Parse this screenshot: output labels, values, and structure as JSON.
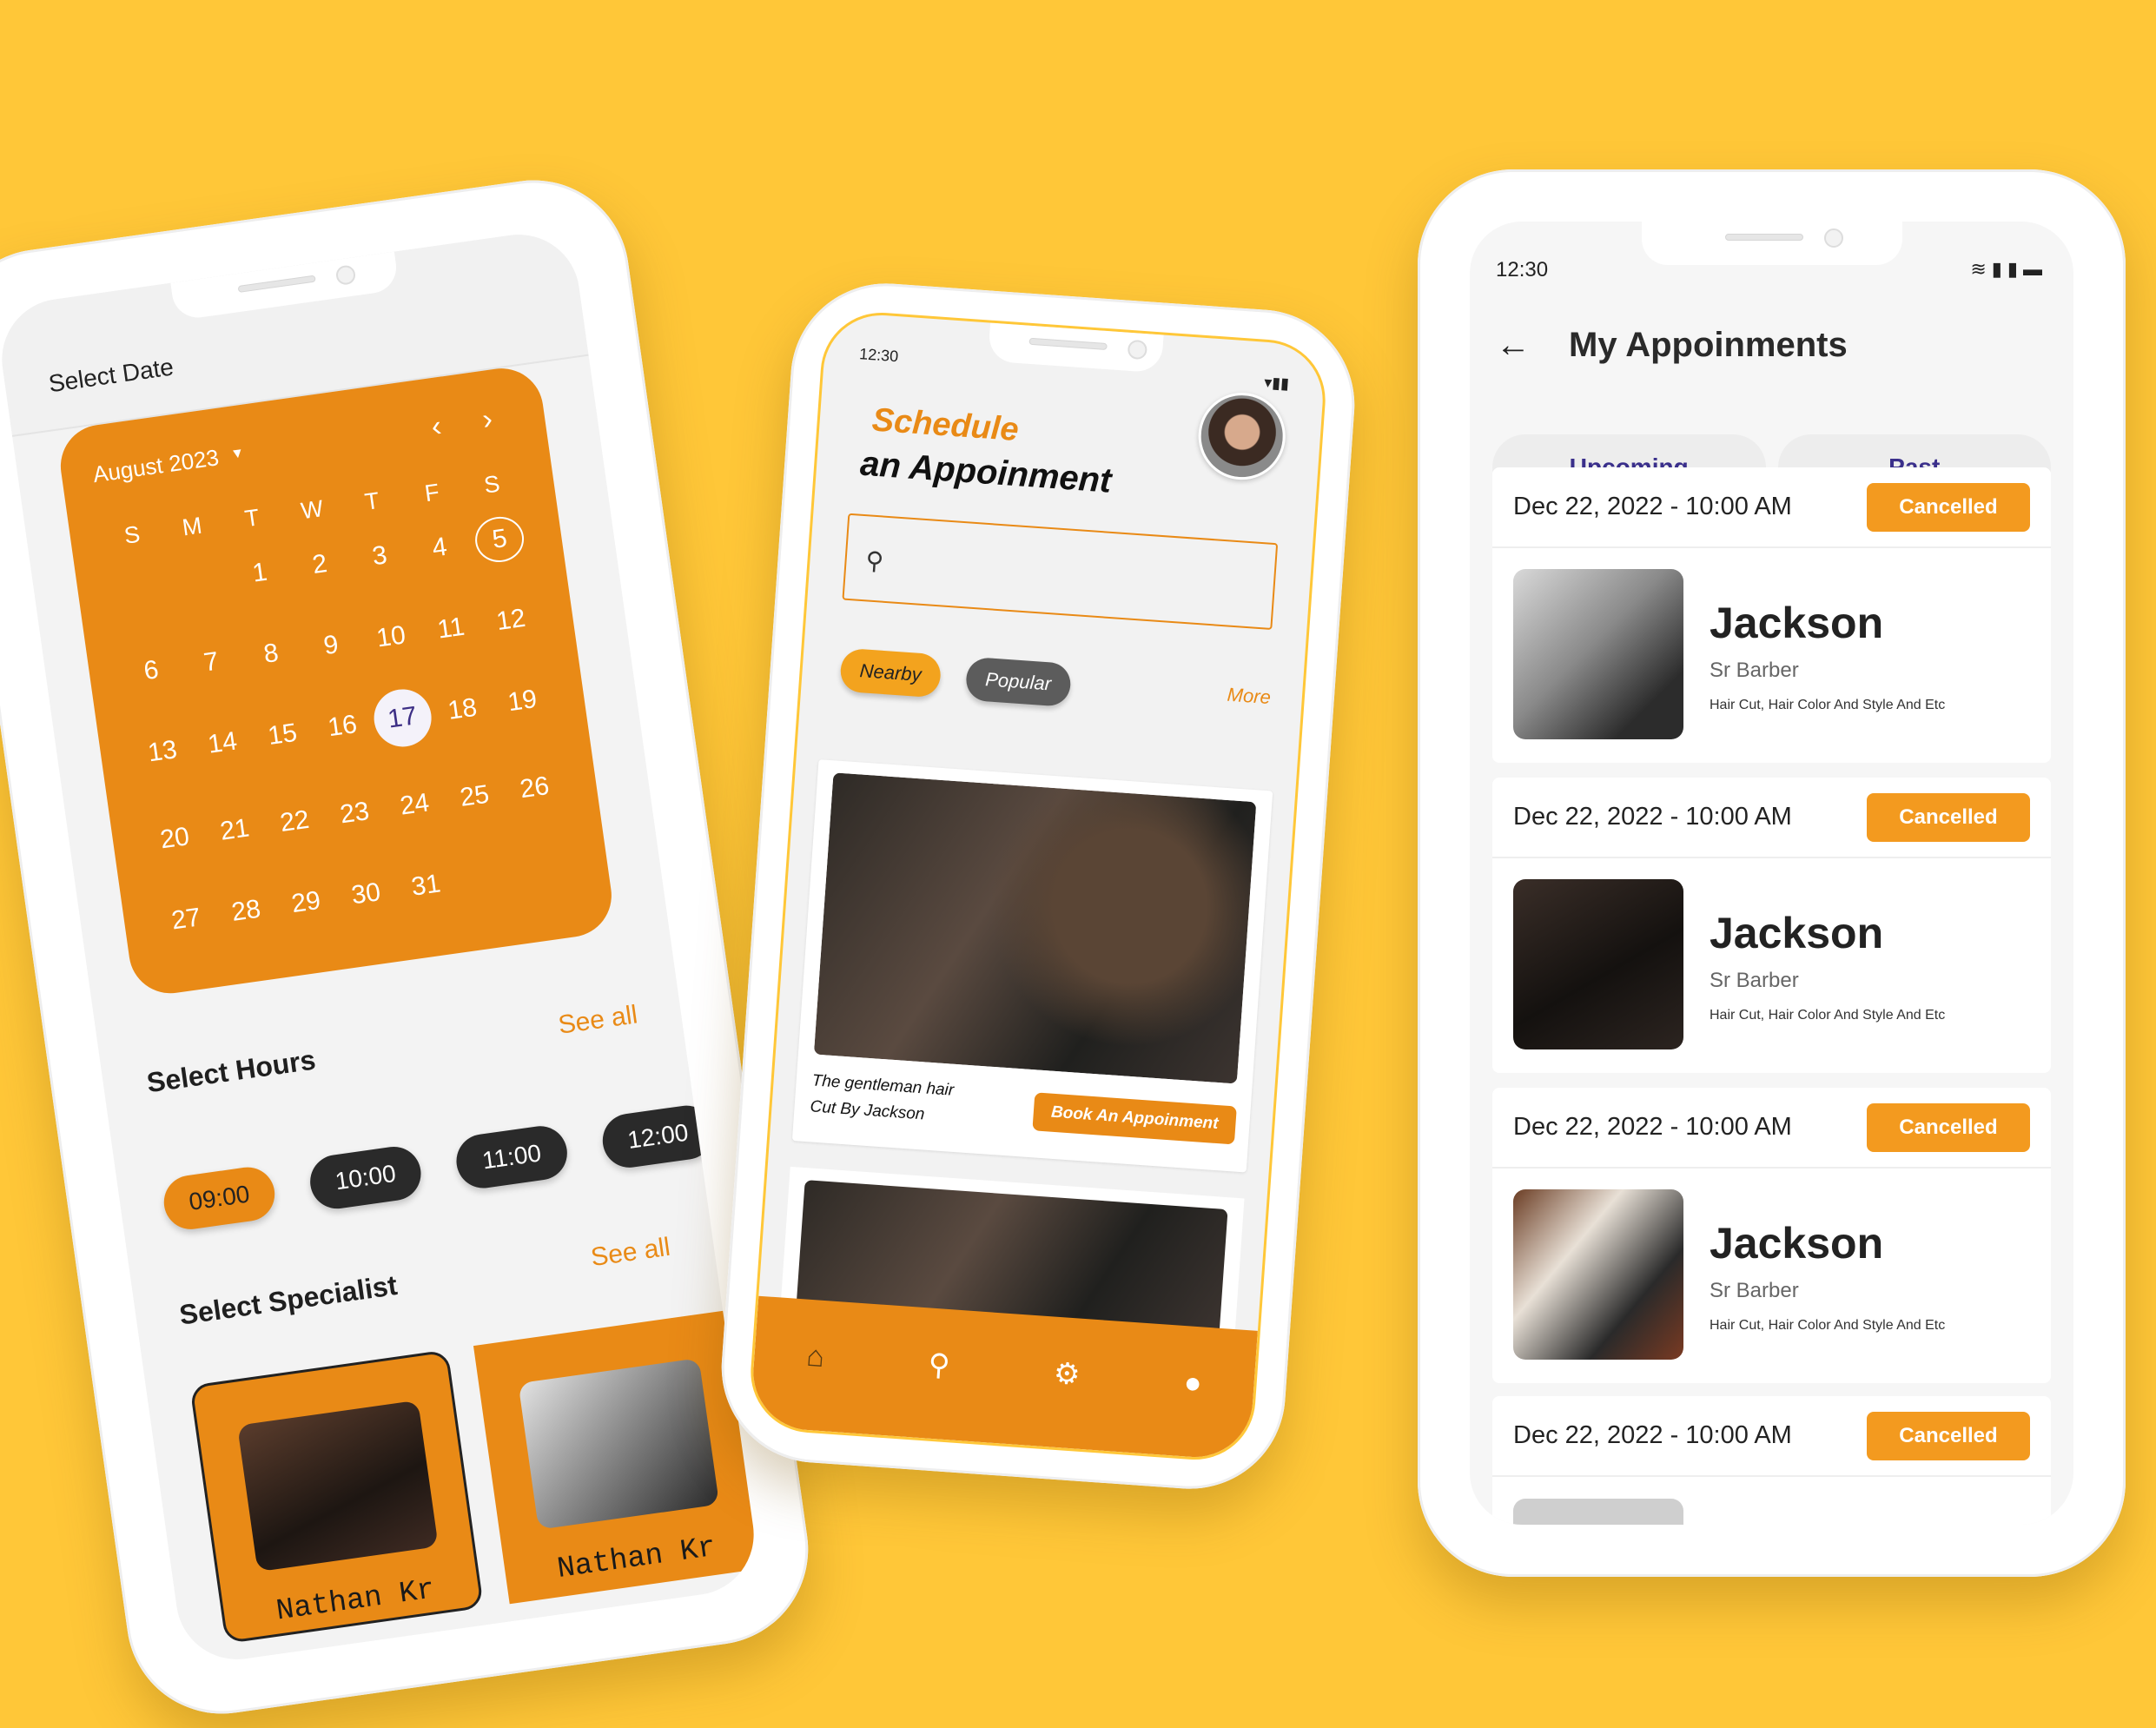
{
  "calendar_screen": {
    "title": "Select Date",
    "month": "August 2023",
    "weekdays": [
      "S",
      "M",
      "T",
      "W",
      "T",
      "F",
      "S"
    ],
    "days": [
      "",
      "",
      "1",
      "2",
      "3",
      "4",
      "5",
      "6",
      "7",
      "8",
      "9",
      "10",
      "11",
      "12",
      "13",
      "14",
      "15",
      "16",
      "17",
      "18",
      "19",
      "20",
      "21",
      "22",
      "23",
      "24",
      "25",
      "26",
      "27",
      "28",
      "29",
      "30",
      "31"
    ],
    "ringed_day": "5",
    "selected_day": "17",
    "hours_title": "Select Hours",
    "see_all": "See all",
    "hours": [
      "09:00",
      "10:00",
      "11:00",
      "12:00"
    ],
    "specialist_title": "Select Specialist",
    "specialists": [
      "Nathan Kr",
      "Nathan Kr"
    ]
  },
  "schedule_screen": {
    "status_time": "12:30",
    "heading_line1": "Schedule",
    "heading_line2": "an Appoinment",
    "filters": [
      "Nearby",
      "Popular"
    ],
    "more": "More",
    "post_caption": "The gentleman hair Cut By Jackson",
    "book_button": "Book An Appoinment"
  },
  "appointments_screen": {
    "status_time": "12:30",
    "title": "My Appoinments",
    "tabs": [
      "Upcoming",
      "Past"
    ],
    "appointments": [
      {
        "datetime": "Dec 22, 2022 - 10:00 AM",
        "status": "Cancelled",
        "name": "Jackson",
        "role": "Sr Barber",
        "services": "Hair Cut, Hair Color And Style And Etc"
      },
      {
        "datetime": "Dec 22, 2022 - 10:00 AM",
        "status": "Cancelled",
        "name": "Jackson",
        "role": "Sr Barber",
        "services": "Hair Cut, Hair Color And Style And Etc"
      },
      {
        "datetime": "Dec 22, 2022 - 10:00 AM",
        "status": "Cancelled",
        "name": "Jackson",
        "role": "Sr Barber",
        "services": "Hair Cut, Hair Color And Style And Etc"
      },
      {
        "datetime": "Dec 22, 2022 - 10:00 AM",
        "status": "Cancelled"
      }
    ]
  },
  "colors": {
    "background": "#FFC738",
    "accent": "#E98A16",
    "tab_text": "#3A2F8B"
  }
}
